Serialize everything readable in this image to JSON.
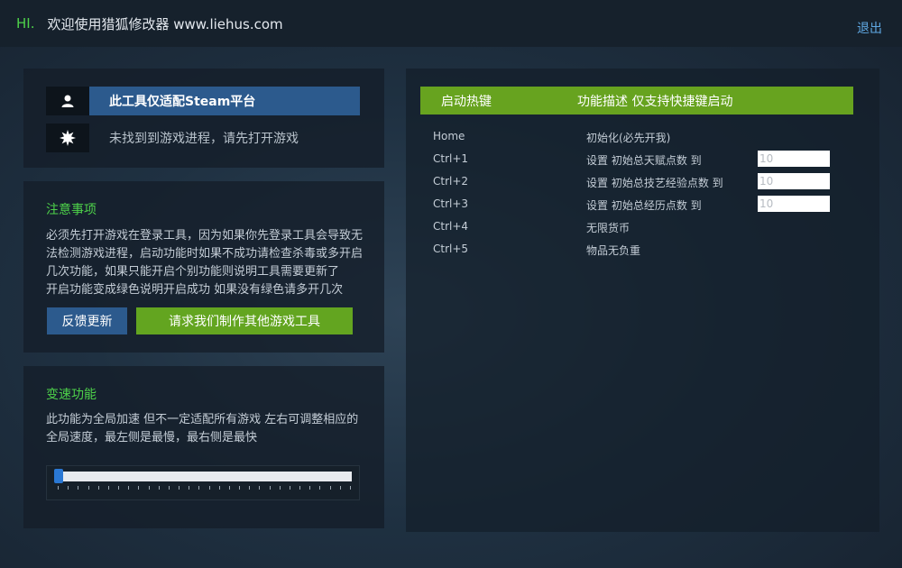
{
  "titlebar": {
    "hi": "HI.",
    "title": "欢迎使用猎狐修改器 www.liehus.com",
    "logout": "退出"
  },
  "status": {
    "user_icon": "user-icon",
    "gear_icon": "gear-icon",
    "steam_notice": "此工具仅适配Steam平台",
    "process_status": "未找到到游戏进程，请先打开游戏"
  },
  "notice": {
    "title": "注意事项",
    "lines": [
      "必须先打开游戏在登录工具，因为如果你先登录工具会导致无",
      "法检测游戏进程，启动功能时如果不成功请检查杀毒或多开启",
      "几次功能，如果只能开启个别功能则说明工具需要更新了",
      "开启功能变成绿色说明开启成功 如果没有绿色请多开几次"
    ],
    "feedback_button": "反馈更新",
    "request_button": "请求我们制作其他游戏工具"
  },
  "speed": {
    "title": "变速功能",
    "lines": [
      "此功能为全局加速 但不一定适配所有游戏 左右可调整相应的",
      "全局速度，最左侧是最慢，最右侧是最快"
    ],
    "slider_value": 0
  },
  "hotkeys": {
    "header_key": "启动热键",
    "header_desc": "功能描述 仅支持快捷键启动",
    "rows": [
      {
        "key": "Home",
        "desc": "初始化(必先开我)",
        "input": ""
      },
      {
        "key": "Ctrl+1",
        "desc": "设置 初始总天赋点数 到",
        "input": "10"
      },
      {
        "key": "Ctrl+2",
        "desc": "设置 初始总技艺经验点数 到",
        "input": "10"
      },
      {
        "key": "Ctrl+3",
        "desc": "设置 初始总经历点数 到",
        "input": "10"
      },
      {
        "key": "Ctrl+4",
        "desc": "无限货币",
        "input": ""
      },
      {
        "key": "Ctrl+5",
        "desc": "物品无负重",
        "input": ""
      }
    ]
  },
  "colors": {
    "accent_green": "#63a520",
    "accent_blue": "#2c5a8d",
    "title_green": "#4ed24a",
    "link_blue": "#5fa8e2"
  }
}
